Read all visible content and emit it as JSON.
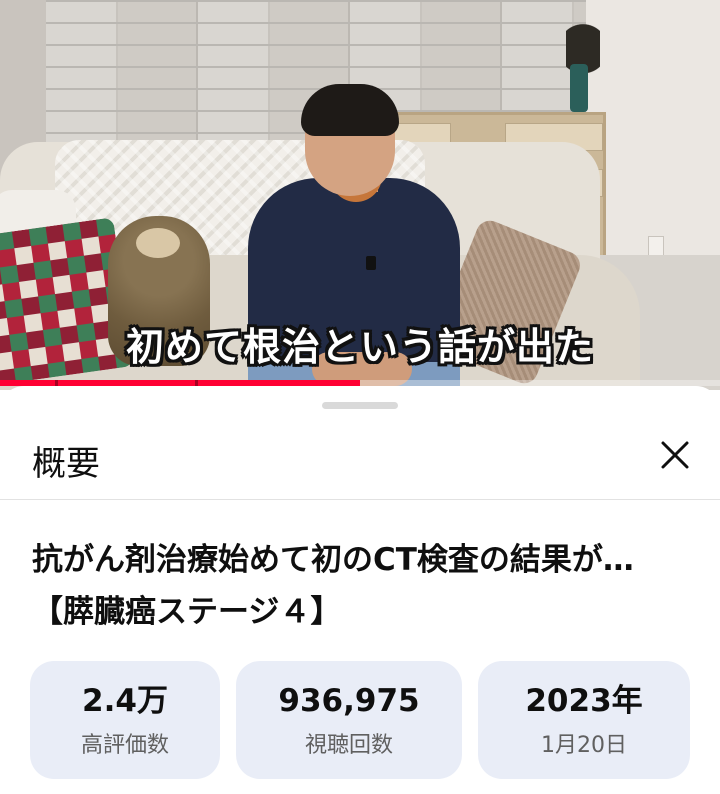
{
  "video": {
    "subtitle": "初めて根治という話が出た",
    "progress": 0.5
  },
  "sheet": {
    "title": "概要",
    "close_icon": "close-icon",
    "video_title_line1": "抗がん剤治療始めて初のCT検査の結果が…",
    "video_title_line2": "【膵臓癌ステージ４】",
    "stats": [
      {
        "value": "2.4万",
        "label": "高評価数"
      },
      {
        "value": "936,975",
        "label": "視聴回数"
      },
      {
        "value": "2023年",
        "label": "1月20日"
      }
    ]
  },
  "colors": {
    "progress": "#ff0033",
    "stat_bg": "#e9edf7",
    "text_primary": "#0f0f0f",
    "text_secondary": "#606060"
  }
}
